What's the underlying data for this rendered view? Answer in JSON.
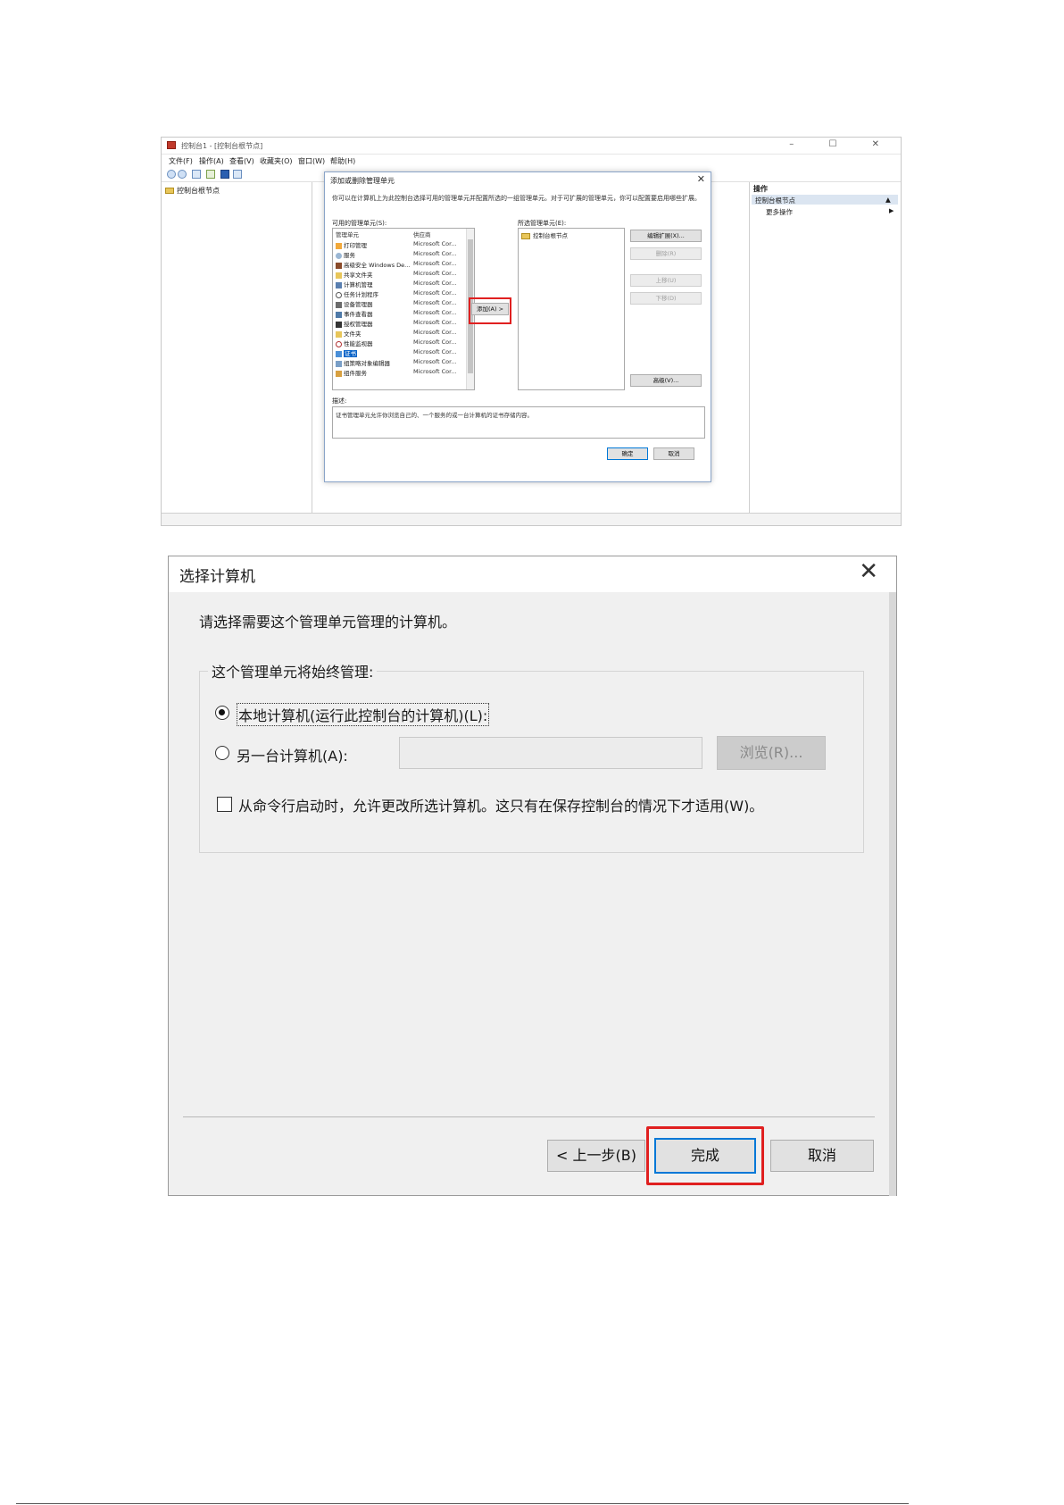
{
  "mmc": {
    "title": "控制台1 - [控制台根节点]",
    "window_controls": "– ☐ ✕",
    "menu": [
      "文件(F)",
      "操作(A)",
      "查看(V)",
      "收藏夹(O)",
      "窗口(W)",
      "帮助(H)"
    ],
    "left_tree_root": "控制台根节点",
    "actions_header": "操作",
    "actions_selected": "控制台根节点",
    "actions_more": "更多操作",
    "dialog": {
      "title": "添加或删除管理单元",
      "description": "你可以在计算机上为此控制台选择可用的管理单元并配置所选的一组管理单元。对于可扩展的管理单元，你可以配置要启用哪些扩展。",
      "available_label": "可用的管理单元(S):",
      "col_snapin": "管理单元",
      "col_vendor": "供应商",
      "available": [
        {
          "name": "打印管理",
          "vendor": "Microsoft Cor..."
        },
        {
          "name": "服务",
          "vendor": "Microsoft Cor..."
        },
        {
          "name": "高级安全 Windows De...",
          "vendor": "Microsoft Cor..."
        },
        {
          "name": "共享文件夹",
          "vendor": "Microsoft Cor..."
        },
        {
          "name": "计算机管理",
          "vendor": "Microsoft Cor..."
        },
        {
          "name": "任务计划程序",
          "vendor": "Microsoft Cor..."
        },
        {
          "name": "设备管理器",
          "vendor": "Microsoft Cor..."
        },
        {
          "name": "事件查看器",
          "vendor": "Microsoft Cor..."
        },
        {
          "name": "授权管理器",
          "vendor": "Microsoft Cor..."
        },
        {
          "name": "文件夹",
          "vendor": "Microsoft Cor..."
        },
        {
          "name": "性能监视器",
          "vendor": "Microsoft Cor..."
        },
        {
          "name": "证书",
          "vendor": "Microsoft Cor..."
        },
        {
          "name": "组策略对象编辑器",
          "vendor": "Microsoft Cor..."
        },
        {
          "name": "组件服务",
          "vendor": "Microsoft Cor..."
        }
      ],
      "selected_row_index": 11,
      "add_button": "添加(A) >",
      "selected_label": "所选管理单元(E):",
      "selected_items": [
        "控制台根节点"
      ],
      "edit_extensions": "编辑扩展(X)...",
      "remove": "删除(R)",
      "move_up": "上移(U)",
      "move_down": "下移(D)",
      "advanced": "高级(V)...",
      "desc_label": "描述:",
      "desc_text": "证书管理单元允许你浏览自己的、一个服务的或一台计算机的证书存储内容。",
      "ok": "确定",
      "cancel": "取消"
    }
  },
  "select_computer": {
    "title": "选择计算机",
    "close_glyph": "✕",
    "prompt": "请选择需要这个管理单元管理的计算机。",
    "group_label": "这个管理单元将始终管理:",
    "local_label": "本地计算机(运行此控制台的计算机)(L):",
    "local_selected": true,
    "other_label": "另一台计算机(A):",
    "other_value": "",
    "browse": "浏览(R)...",
    "allow_change_label": "从命令行启动时，允许更改所选计算机。这只有在保存控制台的情况下才适用(W)。",
    "allow_change_checked": false,
    "back": "< 上一步(B)",
    "finish": "完成",
    "cancel": "取消"
  },
  "colors": {
    "highlight_red": "#e02020",
    "focus_blue": "#0078d7",
    "selection_blue": "#0a64c8"
  }
}
